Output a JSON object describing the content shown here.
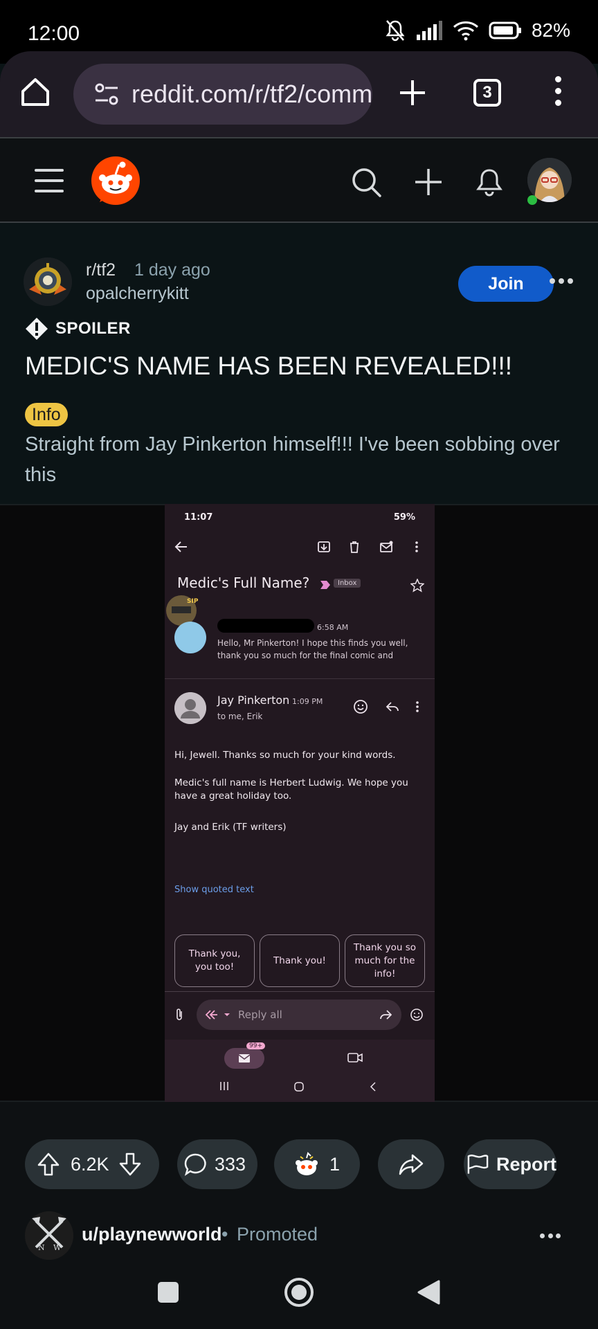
{
  "status_bar": {
    "time": "12:00",
    "battery": "82%"
  },
  "browser": {
    "url": "reddit.com/r/tf2/comm",
    "tab_count": "3"
  },
  "post": {
    "subreddit": "r/tf2",
    "age": "1 day ago",
    "author": "opalcherrykitt",
    "join_label": "Join",
    "spoiler_label": "SPOILER",
    "title": "MEDIC'S NAME HAS BEEN REVEALED!!!",
    "flair": "Info",
    "body": "Straight from Jay Pinkerton himself!!! I've been sobbing over this"
  },
  "screenshot": {
    "status_time": "11:07",
    "status_battery": "59%",
    "subject": "Medic's Full Name?",
    "label_inbox": "Inbox",
    "sticker_text": "SIP",
    "first_time": "6:58 AM",
    "first_snippet": "Hello, Mr Pinkerton! I hope this finds you well, thank you so much for the final comic and",
    "sender": "Jay Pinkerton",
    "sender_time": "1:09 PM",
    "recipients": "to me, Erik",
    "body_lines": [
      "Hi, Jewell. Thanks so much for your kind words.",
      "Medic's full name is Herbert Ludwig. We hope you have a great holiday too.",
      "Jay and Erik (TF writers)"
    ],
    "show_quoted": "Show quoted text",
    "smart_replies": [
      "Thank you, you too!",
      "Thank you!",
      "Thank you so much for the info!"
    ],
    "reply_placeholder": "Reply all",
    "mail_badge": "99+"
  },
  "actions": {
    "upvotes": "6.2K",
    "comments": "333",
    "awards": "1",
    "report_label": "Report"
  },
  "promoted": {
    "user": "u/playnewworld",
    "separator": "•",
    "label": "Promoted",
    "avatar_letters": [
      "N",
      "W"
    ]
  },
  "colors": {
    "join_button": "#115bca",
    "flair_background": "#eec443",
    "reddit_orange": "#ff4500"
  }
}
